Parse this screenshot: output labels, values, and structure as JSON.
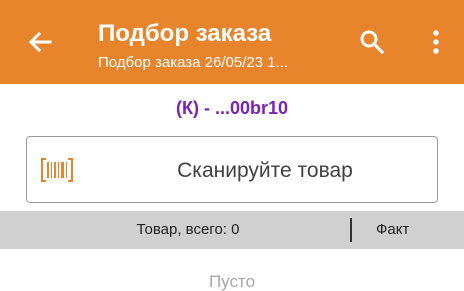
{
  "appbar": {
    "title": "Подбор заказа",
    "subtitle": "Подбор заказа 26/05/23 1...",
    "back_icon": "arrow-left-icon",
    "search_icon": "search-icon",
    "more_icon": "more-vertical-icon",
    "color": "#e8842c"
  },
  "document": {
    "id": "(К) - ...00br10",
    "color": "#7b22b8"
  },
  "scan": {
    "icon": "barcode-scan-icon",
    "label": "Сканируйте товар",
    "icon_color": "#e8842c"
  },
  "table": {
    "total_label": "Товар, всего: 0",
    "fact_label": "Факт"
  },
  "list": {
    "empty_text": "Пусто"
  }
}
